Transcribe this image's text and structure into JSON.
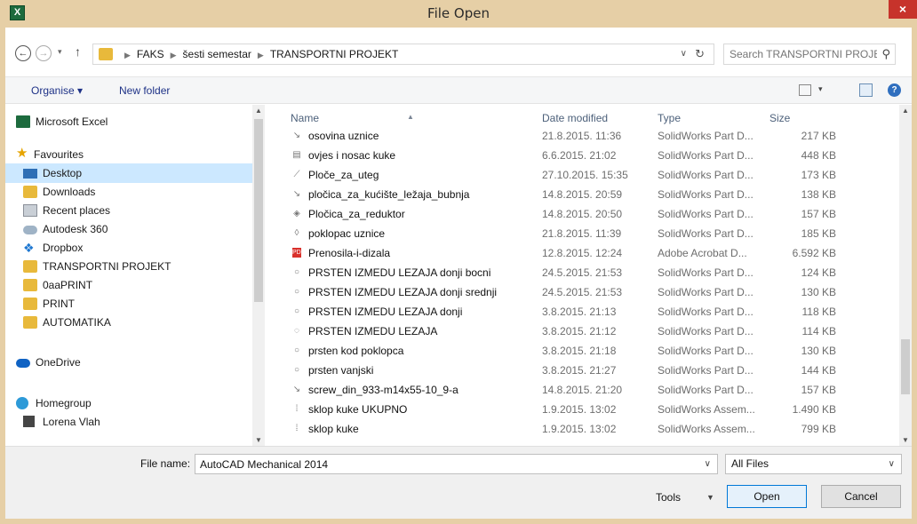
{
  "window": {
    "title": "File Open",
    "app_icon": "X",
    "close": "×"
  },
  "address": {
    "back": "←",
    "forward": "→",
    "recent": "▾",
    "up": "↑",
    "crumbs": [
      "FAKS",
      "šesti semestar",
      "TRANSPORTNI PROJEKT"
    ],
    "dropdown": "∨",
    "refresh": "↻",
    "search_placeholder": "Search TRANSPORTNI PROJEKT",
    "search_icon": "⚲"
  },
  "toolbar": {
    "organise": "Organise ▾",
    "new_folder": "New folder",
    "view_arrow": "▾",
    "help": "?"
  },
  "nav": {
    "items": [
      {
        "label": "Microsoft Excel",
        "icon": "excel-icon"
      },
      {
        "label": "Favourites",
        "icon": "star-icon"
      },
      {
        "label": "Desktop",
        "icon": "desktop-icon",
        "selected": true
      },
      {
        "label": "Downloads",
        "icon": "folder-icon"
      },
      {
        "label": "Recent places",
        "icon": "recent-places-icon"
      },
      {
        "label": "Autodesk 360",
        "icon": "cloud-icon"
      },
      {
        "label": "Dropbox",
        "icon": "dropbox-icon"
      },
      {
        "label": "TRANSPORTNI PROJEKT",
        "icon": "folder-icon"
      },
      {
        "label": "0aaPRINT",
        "icon": "folder-icon"
      },
      {
        "label": "PRINT",
        "icon": "folder-icon"
      },
      {
        "label": "AUTOMATIKA",
        "icon": "folder-icon"
      },
      {
        "label": "OneDrive",
        "icon": "onedrive-icon"
      },
      {
        "label": "Homegroup",
        "icon": "homegroup-icon"
      },
      {
        "label": "Lorena Vlah",
        "icon": "user-icon"
      }
    ],
    "scroll_up": "▲",
    "scroll_down": "▼"
  },
  "files": {
    "headers": {
      "name": "Name",
      "date": "Date modified",
      "type": "Type",
      "size": "Size",
      "sort": "▲"
    },
    "rows": [
      {
        "name": "osovina uznice",
        "date": "21.8.2015. 11:36",
        "type": "SolidWorks Part D...",
        "size": "217 KB",
        "icon": "part-icon",
        "glyph": "↘"
      },
      {
        "name": "ovjes i nosac kuke",
        "date": "6.6.2015. 21:02",
        "type": "SolidWorks Part D...",
        "size": "448 KB",
        "icon": "part-icon",
        "glyph": "▤"
      },
      {
        "name": "Ploče_za_uteg",
        "date": "27.10.2015. 15:35",
        "type": "SolidWorks Part D...",
        "size": "173 KB",
        "icon": "part-icon",
        "glyph": "⟋"
      },
      {
        "name": "pločica_za_kućište_ležaja_bubnja",
        "date": "14.8.2015. 20:59",
        "type": "SolidWorks Part D...",
        "size": "138 KB",
        "icon": "part-icon",
        "glyph": "↘"
      },
      {
        "name": "Pločica_za_reduktor",
        "date": "14.8.2015. 20:50",
        "type": "SolidWorks Part D...",
        "size": "157 KB",
        "icon": "part-icon",
        "glyph": "◈"
      },
      {
        "name": "poklopac uznice",
        "date": "21.8.2015. 11:39",
        "type": "SolidWorks Part D...",
        "size": "185 KB",
        "icon": "part-icon",
        "glyph": "◊"
      },
      {
        "name": "Prenosila-i-dizala",
        "date": "12.8.2015. 12:24",
        "type": "Adobe Acrobat D...",
        "size": "6.592 KB",
        "icon": "pdf-icon",
        "glyph": "PDF"
      },
      {
        "name": "PRSTEN IZMEDU LEZAJA donji bocni",
        "date": "24.5.2015. 21:53",
        "type": "SolidWorks Part D...",
        "size": "124 KB",
        "icon": "part-icon",
        "glyph": "○"
      },
      {
        "name": "PRSTEN IZMEDU LEZAJA donji srednji",
        "date": "24.5.2015. 21:53",
        "type": "SolidWorks Part D...",
        "size": "130 KB",
        "icon": "part-icon",
        "glyph": "○"
      },
      {
        "name": "PRSTEN IZMEDU LEZAJA donji",
        "date": "3.8.2015. 21:13",
        "type": "SolidWorks Part D...",
        "size": "118 KB",
        "icon": "part-icon",
        "glyph": "○"
      },
      {
        "name": "PRSTEN IZMEDU LEZAJA",
        "date": "3.8.2015. 21:12",
        "type": "SolidWorks Part D...",
        "size": "114 KB",
        "icon": "part-icon",
        "glyph": "◌"
      },
      {
        "name": "prsten kod poklopca",
        "date": "3.8.2015. 21:18",
        "type": "SolidWorks Part D...",
        "size": "130 KB",
        "icon": "part-icon",
        "glyph": "○"
      },
      {
        "name": "prsten vanjski",
        "date": "3.8.2015. 21:27",
        "type": "SolidWorks Part D...",
        "size": "144 KB",
        "icon": "part-icon",
        "glyph": "○"
      },
      {
        "name": "screw_din_933-m14x55-10_9-a",
        "date": "14.8.2015. 21:20",
        "type": "SolidWorks Part D...",
        "size": "157 KB",
        "icon": "part-icon",
        "glyph": "↘"
      },
      {
        "name": "sklop kuke UKUPNO",
        "date": "1.9.2015. 13:02",
        "type": "SolidWorks Assem...",
        "size": "1.490 KB",
        "icon": "assembly-icon",
        "glyph": "⁞"
      },
      {
        "name": "sklop kuke",
        "date": "1.9.2015. 13:02",
        "type": "SolidWorks Assem...",
        "size": "799 KB",
        "icon": "assembly-icon",
        "glyph": "⁞"
      }
    ],
    "scroll_up": "▲",
    "scroll_down": "▼"
  },
  "bottom": {
    "file_name_label": "File name:",
    "file_name_value": "AutoCAD Mechanical 2014",
    "file_name_dropdown": "∨",
    "file_type": "All Files",
    "file_type_arrow": "∨",
    "tools": "Tools",
    "tools_arrow": "▼",
    "open": "Open",
    "cancel": "Cancel"
  }
}
